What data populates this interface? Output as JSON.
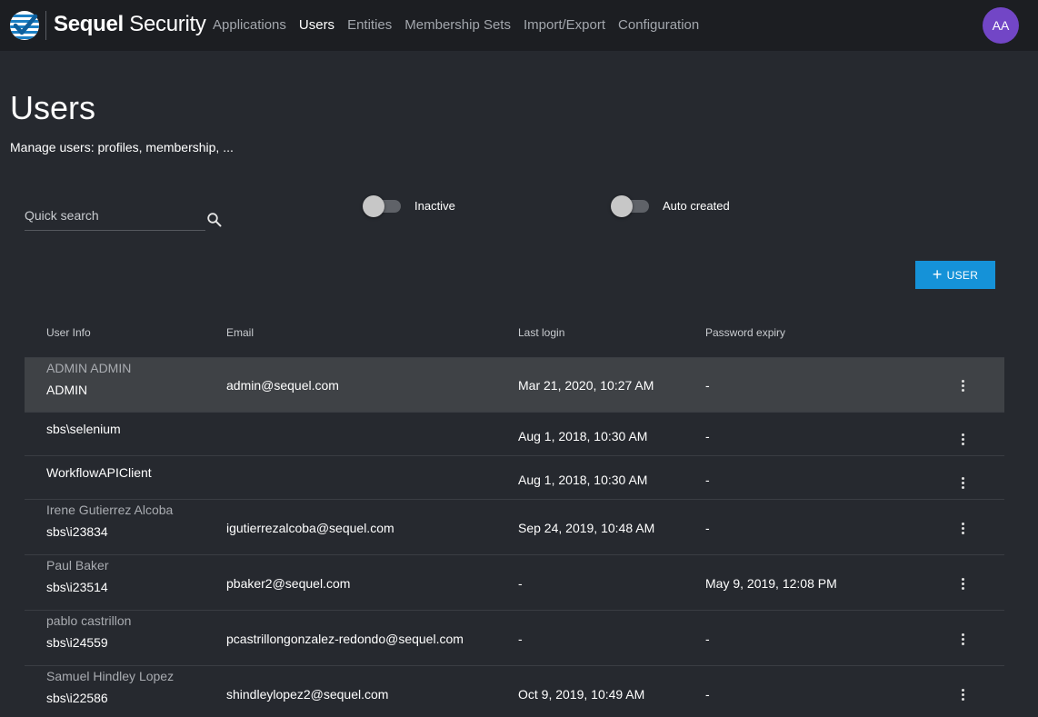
{
  "brand": {
    "bold": "Sequel",
    "light": " Security"
  },
  "nav": [
    {
      "label": "Applications",
      "active": false
    },
    {
      "label": "Users",
      "active": true
    },
    {
      "label": "Entities",
      "active": false
    },
    {
      "label": "Membership Sets",
      "active": false
    },
    {
      "label": "Import/Export",
      "active": false
    },
    {
      "label": "Configuration",
      "active": false
    }
  ],
  "avatar": {
    "initials": "AA",
    "color": "#7246c6"
  },
  "page": {
    "title": "Users",
    "subtitle": "Manage users: profiles, membership, ..."
  },
  "search": {
    "placeholder": "Quick search",
    "value": ""
  },
  "filters": {
    "inactive_label": "Inactive",
    "auto_created_label": "Auto created"
  },
  "toolbar": {
    "add_user_label": "USER",
    "add_user_color": "#1592d8"
  },
  "table": {
    "headers": {
      "user_info": "User Info",
      "email": "Email",
      "last_login": "Last login",
      "password_expiry": "Password expiry"
    },
    "rows": [
      {
        "name": "ADMIN ADMIN",
        "login": "ADMIN",
        "email": "admin@sequel.com",
        "last_login": "Mar 21, 2020, 10:27 AM",
        "password_expiry": "-"
      },
      {
        "name": "",
        "login": "sbs\\selenium",
        "email": "",
        "last_login": "Aug 1, 2018, 10:30 AM",
        "password_expiry": "-"
      },
      {
        "name": "",
        "login": "WorkflowAPIClient",
        "email": "",
        "last_login": "Aug 1, 2018, 10:30 AM",
        "password_expiry": "-"
      },
      {
        "name": "Irene Gutierrez Alcoba",
        "login": "sbs\\i23834",
        "email": "igutierrezalcoba@sequel.com",
        "last_login": "Sep 24, 2019, 10:48 AM",
        "password_expiry": "-"
      },
      {
        "name": "Paul Baker",
        "login": "sbs\\i23514",
        "email": "pbaker2@sequel.com",
        "last_login": "-",
        "password_expiry": "May 9, 2019, 12:08 PM"
      },
      {
        "name": "pablo castrillon",
        "login": "sbs\\i24559",
        "email": "pcastrillongonzalez-redondo@sequel.com",
        "last_login": "-",
        "password_expiry": "-"
      },
      {
        "name": "Samuel Hindley Lopez",
        "login": "sbs\\i22586",
        "email": "shindleylopez2@sequel.com",
        "last_login": "Oct 9, 2019, 10:49 AM",
        "password_expiry": "-"
      }
    ]
  }
}
